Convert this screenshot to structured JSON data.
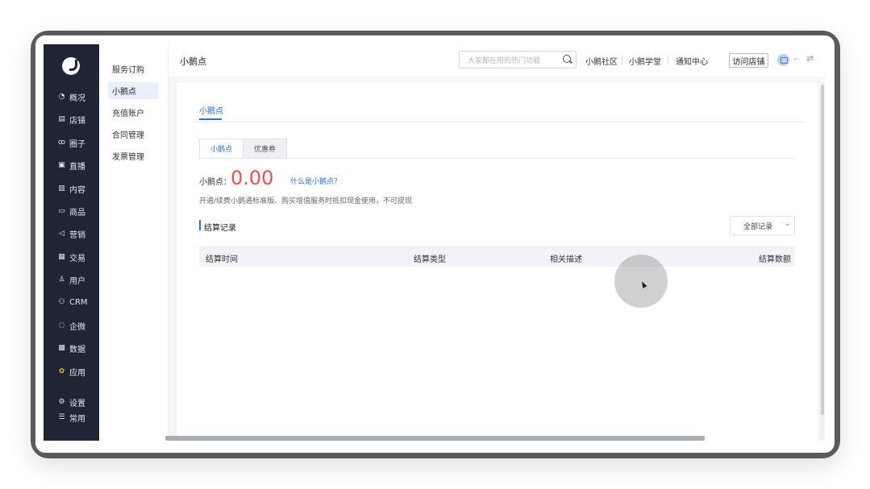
{
  "nav": {
    "items": [
      {
        "label": "概况",
        "icon": "pie-chart-icon"
      },
      {
        "label": "店铺",
        "icon": "store-icon"
      },
      {
        "label": "圈子",
        "icon": "group-icon"
      },
      {
        "label": "直播",
        "icon": "live-icon"
      },
      {
        "label": "内容",
        "icon": "document-icon"
      },
      {
        "label": "商品",
        "icon": "box-icon"
      },
      {
        "label": "营销",
        "icon": "megaphone-icon"
      },
      {
        "label": "交易",
        "icon": "receipt-icon"
      },
      {
        "label": "用户",
        "icon": "user-icon"
      },
      {
        "label": "CRM",
        "icon": "contacts-icon"
      },
      {
        "label": "企微",
        "icon": "wecom-icon"
      },
      {
        "label": "数据",
        "icon": "data-icon"
      },
      {
        "label": "应用",
        "icon": "apps-icon"
      }
    ],
    "bottom": [
      {
        "label": "设置",
        "icon": "gear-icon"
      },
      {
        "label": "常用",
        "icon": "list-icon"
      }
    ]
  },
  "subnav": {
    "items": [
      "服务订购",
      "小鹅点",
      "充值账户",
      "合同管理",
      "发票管理"
    ],
    "active_index": 1
  },
  "header": {
    "title": "小鹅点",
    "search_placeholder": "大家都在用的热门功能",
    "links": [
      "小鹅社区",
      "小鹅学堂",
      "通知中心"
    ],
    "visit_store": "访问店铺"
  },
  "content": {
    "top_tab": "小鹅点",
    "sub_tabs": [
      "小鹅点",
      "优惠券"
    ],
    "points_label": "小鹅点：",
    "points_value": "0.00",
    "what_link": "什么是小鹅点？",
    "description": "开通/续费小鹅通标准版、购买增值服务时抵扣现金使用，不可提现",
    "section_title": "结算记录",
    "filter_value": "全部记录",
    "table_headers": [
      "结算时间",
      "结算类型",
      "相关描述",
      "结算数额"
    ]
  },
  "colors": {
    "accent": "#2b6fe0",
    "points": "#ee4e4e",
    "nav_bg": "#1e2533"
  }
}
